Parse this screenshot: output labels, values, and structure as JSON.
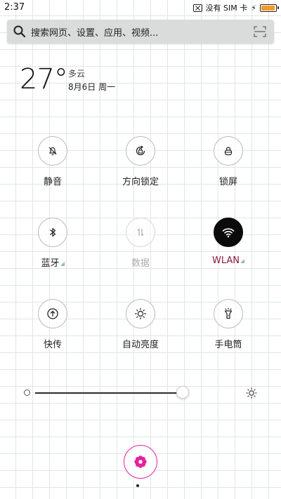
{
  "status_bar": {
    "time": "2:37",
    "carrier": "没有 SIM 卡",
    "battery_level": 0.95,
    "battery_color": "#f39a2c"
  },
  "search": {
    "placeholder": "搜索网页、设置、应用、视频..."
  },
  "weather": {
    "temperature": "27°",
    "condition": "多云",
    "date": "8月6日 周一"
  },
  "toggles": [
    {
      "label": "静音",
      "icon": "bell-off-icon",
      "state": "off"
    },
    {
      "label": "方向锁定",
      "icon": "rotation-lock-icon",
      "state": "off"
    },
    {
      "label": "锁屏",
      "icon": "lock-icon",
      "state": "off"
    },
    {
      "label": "蓝牙",
      "icon": "bluetooth-icon",
      "state": "off"
    },
    {
      "label": "数据",
      "icon": "data-arrows-icon",
      "state": "disabled"
    },
    {
      "label": "WLAN",
      "icon": "wifi-icon",
      "state": "on"
    },
    {
      "label": "快传",
      "icon": "quick-transfer-icon",
      "state": "off"
    },
    {
      "label": "自动亮度",
      "icon": "auto-brightness-icon",
      "state": "off"
    },
    {
      "label": "手电筒",
      "icon": "flashlight-icon",
      "state": "off"
    }
  ],
  "brightness": {
    "level": 0.7
  },
  "accent_colors": {
    "wlan_text": "#8b1a3a",
    "fab": "#e5219e",
    "corner_mark": "#8fb9c2"
  }
}
